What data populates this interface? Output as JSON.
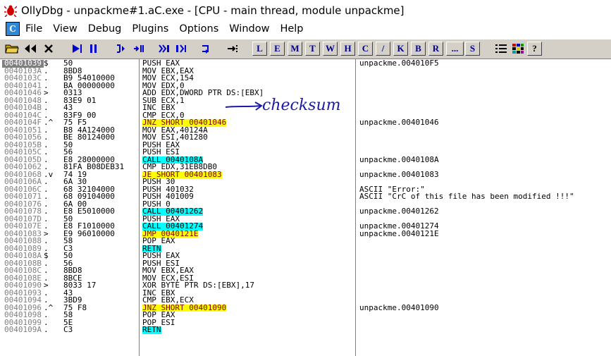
{
  "window": {
    "title": "OllyDbg - unpackme#1.aC.exe - [CPU - main thread, module unpackme]"
  },
  "menu": {
    "icon_label": "C",
    "items": [
      "File",
      "View",
      "Debug",
      "Plugins",
      "Options",
      "Window",
      "Help"
    ]
  },
  "toolbar": {
    "letters": [
      "L",
      "E",
      "M",
      "T",
      "W",
      "H",
      "C",
      "/",
      "K",
      "B",
      "R",
      "...",
      "S"
    ]
  },
  "cpu": {
    "rows": [
      {
        "addr": "00401039",
        "mark": "$",
        "hex": "50",
        "dis": "PUSH EAX",
        "com": "unpackme.004010F5",
        "sel": true
      },
      {
        "addr": "0040103A",
        "mark": ".",
        "hex": "8BD8",
        "dis": "MOV EBX,EAX",
        "com": ""
      },
      {
        "addr": "0040103C",
        "mark": ".",
        "hex": "B9 54010000",
        "dis": "MOV ECX,154",
        "com": ""
      },
      {
        "addr": "00401041",
        "mark": ".",
        "hex": "BA 00000000",
        "dis": "MOV EDX,0",
        "com": ""
      },
      {
        "addr": "00401046",
        "mark": ">",
        "hex": "0313",
        "dis": "ADD EDX,DWORD PTR DS:[EBX]",
        "com": ""
      },
      {
        "addr": "00401048",
        "mark": ".",
        "hex": "83E9 01",
        "dis": "SUB ECX,1",
        "com": ""
      },
      {
        "addr": "0040104B",
        "mark": ".",
        "hex": "43",
        "dis": "INC EBX",
        "com": ""
      },
      {
        "addr": "0040104C",
        "mark": ".",
        "hex": "83F9 00",
        "dis": "CMP ECX,0",
        "com": ""
      },
      {
        "addr": "0040104F",
        "mark": ".^",
        "hex": "75 F5",
        "dis": "JNZ SHORT 00401046",
        "com": "unpackme.00401046",
        "hl": "y"
      },
      {
        "addr": "00401051",
        "mark": ".",
        "hex": "B8 4A124000",
        "dis": "MOV EAX,40124A",
        "com": ""
      },
      {
        "addr": "00401056",
        "mark": ".",
        "hex": "BE 80124000",
        "dis": "MOV ESI,401280",
        "com": ""
      },
      {
        "addr": "0040105B",
        "mark": ".",
        "hex": "50",
        "dis": "PUSH EAX",
        "com": ""
      },
      {
        "addr": "0040105C",
        "mark": ".",
        "hex": "56",
        "dis": "PUSH ESI",
        "com": ""
      },
      {
        "addr": "0040105D",
        "mark": ".",
        "hex": "E8 28000000",
        "dis": "CALL 0040108A",
        "com": "unpackme.0040108A",
        "hl": "c"
      },
      {
        "addr": "00401062",
        "mark": ".",
        "hex": "81FA B08DEB31",
        "dis": "CMP EDX,31EB8DB0",
        "com": ""
      },
      {
        "addr": "00401068",
        "mark": ".v",
        "hex": "74 19",
        "dis": "JE SHORT 00401083",
        "com": "unpackme.00401083",
        "hl": "y"
      },
      {
        "addr": "0040106A",
        "mark": ".",
        "hex": "6A 30",
        "dis": "PUSH 30",
        "com": ""
      },
      {
        "addr": "0040106C",
        "mark": ".",
        "hex": "68 32104000",
        "dis": "PUSH 401032",
        "com": "ASCII \"Error:\""
      },
      {
        "addr": "00401071",
        "mark": ".",
        "hex": "68 09104000",
        "dis": "PUSH 401009",
        "com": "ASCII \"CrC of this file has been modified !!!\""
      },
      {
        "addr": "00401076",
        "mark": ".",
        "hex": "6A 00",
        "dis": "PUSH 0",
        "com": ""
      },
      {
        "addr": "00401078",
        "mark": ".",
        "hex": "E8 E5010000",
        "dis": "CALL 00401262",
        "com": "unpackme.00401262",
        "hl": "c"
      },
      {
        "addr": "0040107D",
        "mark": ".",
        "hex": "50",
        "dis": "PUSH EAX",
        "com": ""
      },
      {
        "addr": "0040107E",
        "mark": ".",
        "hex": "E8 F1010000",
        "dis": "CALL 00401274",
        "com": "unpackme.00401274",
        "hl": "c"
      },
      {
        "addr": "00401083",
        "mark": ">",
        "hex": "E9 96010000",
        "dis": "JMP 0040121E",
        "com": "unpackme.0040121E",
        "hl": "y"
      },
      {
        "addr": "00401088",
        "mark": ".",
        "hex": "58",
        "dis": "POP EAX",
        "com": ""
      },
      {
        "addr": "00401089",
        "mark": ".",
        "hex": "C3",
        "dis": "RETN",
        "com": "",
        "hl": "c"
      },
      {
        "addr": "0040108A",
        "mark": "$",
        "hex": "50",
        "dis": "PUSH EAX",
        "com": ""
      },
      {
        "addr": "0040108B",
        "mark": ".",
        "hex": "56",
        "dis": "PUSH ESI",
        "com": ""
      },
      {
        "addr": "0040108C",
        "mark": ".",
        "hex": "8BD8",
        "dis": "MOV EBX,EAX",
        "com": ""
      },
      {
        "addr": "0040108E",
        "mark": ".",
        "hex": "8BCE",
        "dis": "MOV ECX,ESI",
        "com": ""
      },
      {
        "addr": "00401090",
        "mark": ">",
        "hex": "8033 17",
        "dis": "XOR BYTE PTR DS:[EBX],17",
        "com": ""
      },
      {
        "addr": "00401093",
        "mark": ".",
        "hex": "43",
        "dis": "INC EBX",
        "com": ""
      },
      {
        "addr": "00401094",
        "mark": ".",
        "hex": "3BD9",
        "dis": "CMP EBX,ECX",
        "com": ""
      },
      {
        "addr": "00401096",
        "mark": ".^",
        "hex": "75 F8",
        "dis": "JNZ SHORT 00401090",
        "com": "unpackme.00401090",
        "hl": "y"
      },
      {
        "addr": "00401098",
        "mark": ".",
        "hex": "58",
        "dis": "POP EAX",
        "com": ""
      },
      {
        "addr": "00401099",
        "mark": ".",
        "hex": "5E",
        "dis": "POP ESI",
        "com": ""
      },
      {
        "addr": "0040109A",
        "mark": ".",
        "hex": "C3",
        "dis": "RETN",
        "com": "",
        "hl": "c"
      }
    ]
  },
  "annotation": {
    "text": "checksum"
  }
}
